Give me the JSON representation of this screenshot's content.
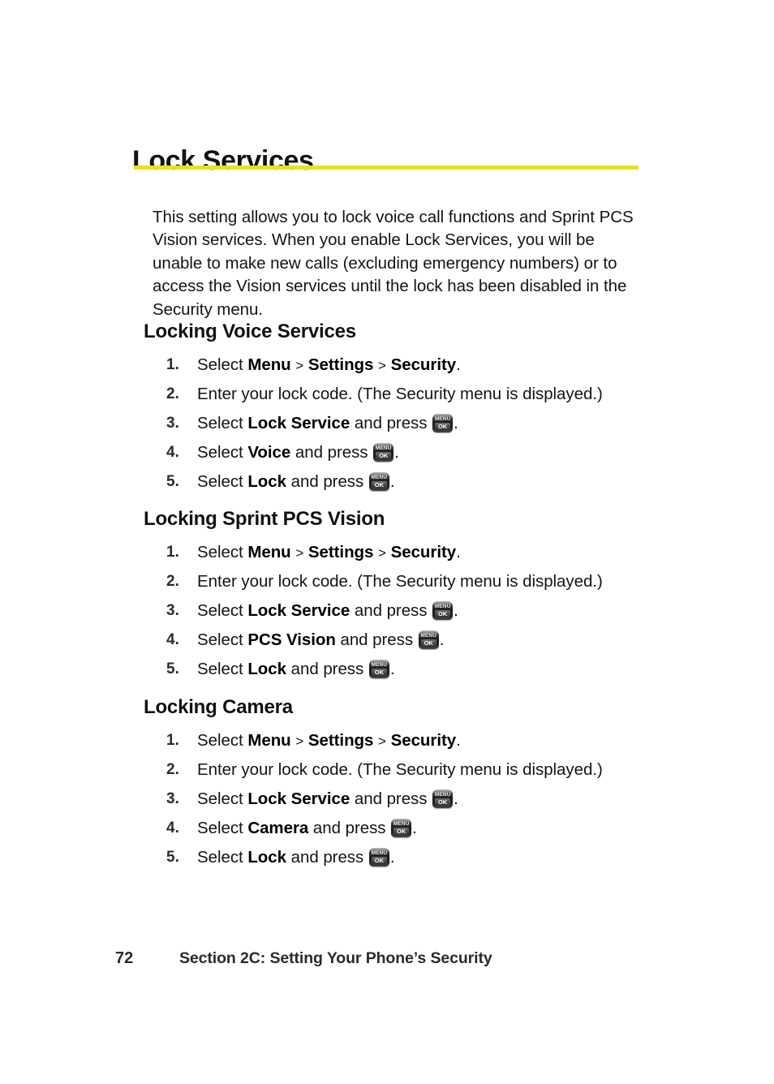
{
  "document": {
    "title": "Lock Services",
    "rule_color": "#ebdf1e",
    "intro": "This setting allows you to lock voice call functions and Sprint PCS Vision services. When you enable Lock Services, you will be unable to make new calls (excluding emergency numbers) or to access the Vision services until the lock has been disabled in the Security menu."
  },
  "key_icon": {
    "top_label": "MENU",
    "bottom_label": "OK"
  },
  "sections": [
    {
      "heading": "Locking Voice Services",
      "steps": [
        {
          "number": "1.",
          "parts": [
            {
              "t": "Select ",
              "b": false
            },
            {
              "t": "Menu",
              "b": true
            },
            {
              "t": " > ",
              "b": false,
              "chev": true
            },
            {
              "t": "Settings",
              "b": true
            },
            {
              "t": " > ",
              "b": false,
              "chev": true
            },
            {
              "t": "Security",
              "b": true
            },
            {
              "t": ".",
              "b": false
            }
          ]
        },
        {
          "number": "2.",
          "parts": [
            {
              "t": "Enter your lock code. (The Security menu is displayed.)",
              "b": false
            }
          ]
        },
        {
          "number": "3.",
          "parts": [
            {
              "t": "Select ",
              "b": false
            },
            {
              "t": "Lock Service",
              "b": true
            },
            {
              "t": " and press ",
              "b": false
            },
            {
              "icon": true
            },
            {
              "t": ".",
              "b": false
            }
          ]
        },
        {
          "number": "4.",
          "parts": [
            {
              "t": "Select ",
              "b": false
            },
            {
              "t": "Voice",
              "b": true
            },
            {
              "t": " and press ",
              "b": false
            },
            {
              "icon": true
            },
            {
              "t": ".",
              "b": false
            }
          ]
        },
        {
          "number": "5.",
          "parts": [
            {
              "t": "Select ",
              "b": false
            },
            {
              "t": "Lock",
              "b": true
            },
            {
              "t": " and press ",
              "b": false
            },
            {
              "icon": true
            },
            {
              "t": ".",
              "b": false
            }
          ]
        }
      ]
    },
    {
      "heading": "Locking Sprint PCS Vision",
      "steps": [
        {
          "number": "1.",
          "parts": [
            {
              "t": "Select ",
              "b": false
            },
            {
              "t": "Menu",
              "b": true
            },
            {
              "t": " > ",
              "b": false,
              "chev": true
            },
            {
              "t": "Settings",
              "b": true
            },
            {
              "t": " > ",
              "b": false,
              "chev": true
            },
            {
              "t": "Security",
              "b": true
            },
            {
              "t": ".",
              "b": false
            }
          ]
        },
        {
          "number": "2.",
          "parts": [
            {
              "t": "Enter your lock code. (The Security menu is displayed.)",
              "b": false
            }
          ]
        },
        {
          "number": "3.",
          "parts": [
            {
              "t": "Select ",
              "b": false
            },
            {
              "t": "Lock Service",
              "b": true
            },
            {
              "t": " and press ",
              "b": false
            },
            {
              "icon": true
            },
            {
              "t": ".",
              "b": false
            }
          ]
        },
        {
          "number": "4.",
          "parts": [
            {
              "t": "Select ",
              "b": false
            },
            {
              "t": "PCS Vision",
              "b": true
            },
            {
              "t": " and press ",
              "b": false
            },
            {
              "icon": true
            },
            {
              "t": ".",
              "b": false
            }
          ]
        },
        {
          "number": "5.",
          "parts": [
            {
              "t": "Select ",
              "b": false
            },
            {
              "t": "Lock",
              "b": true
            },
            {
              "t": " and press ",
              "b": false
            },
            {
              "icon": true
            },
            {
              "t": ".",
              "b": false
            }
          ]
        }
      ]
    },
    {
      "heading": "Locking Camera",
      "steps": [
        {
          "number": "1.",
          "parts": [
            {
              "t": "Select ",
              "b": false
            },
            {
              "t": "Menu",
              "b": true
            },
            {
              "t": " > ",
              "b": false,
              "chev": true
            },
            {
              "t": "Settings",
              "b": true
            },
            {
              "t": " > ",
              "b": false,
              "chev": true
            },
            {
              "t": "Security",
              "b": true
            },
            {
              "t": ".",
              "b": false
            }
          ]
        },
        {
          "number": "2.",
          "parts": [
            {
              "t": "Enter your lock code. (The Security menu is displayed.)",
              "b": false
            }
          ]
        },
        {
          "number": "3.",
          "parts": [
            {
              "t": "Select ",
              "b": false
            },
            {
              "t": "Lock Service",
              "b": true
            },
            {
              "t": " and press ",
              "b": false
            },
            {
              "icon": true
            },
            {
              "t": ".",
              "b": false
            }
          ]
        },
        {
          "number": "4.",
          "parts": [
            {
              "t": "Select ",
              "b": false
            },
            {
              "t": "Camera",
              "b": true
            },
            {
              "t": " and press ",
              "b": false
            },
            {
              "icon": true
            },
            {
              "t": ".",
              "b": false
            }
          ]
        },
        {
          "number": "5.",
          "parts": [
            {
              "t": "Select ",
              "b": false
            },
            {
              "t": "Lock",
              "b": true
            },
            {
              "t": " and press ",
              "b": false
            },
            {
              "icon": true
            },
            {
              "t": ".",
              "b": false
            }
          ]
        }
      ]
    }
  ],
  "footer": {
    "page_number": "72",
    "section_label": "Section 2C: Setting Your Phone’s Security"
  },
  "layout": {
    "section_tops": [
      394,
      625,
      857
    ]
  }
}
